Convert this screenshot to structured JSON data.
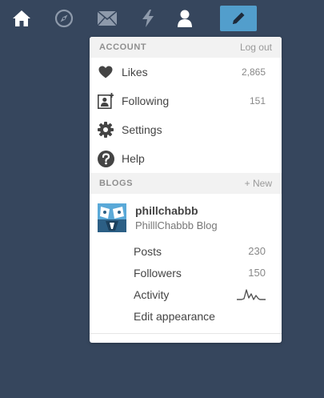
{
  "nav": {
    "icons": [
      "home-icon",
      "explore-icon",
      "mail-icon",
      "activity-icon",
      "account-icon"
    ],
    "compose_icon": "pencil-icon",
    "colors": {
      "background": "#36465d",
      "icon": "#ffffff",
      "compose_bg": "#529ecc"
    }
  },
  "account": {
    "header": "ACCOUNT",
    "logout": "Log out",
    "items": [
      {
        "icon": "heart-icon",
        "label": "Likes",
        "count": "2,865"
      },
      {
        "icon": "following-icon",
        "label": "Following",
        "count": "151"
      },
      {
        "icon": "gear-icon",
        "label": "Settings",
        "count": ""
      },
      {
        "icon": "help-icon",
        "label": "Help",
        "count": ""
      }
    ]
  },
  "blogs": {
    "header": "BLOGS",
    "new": "+ New",
    "blog": {
      "name": "phillchabbb",
      "title": "PhilllChabbb Blog",
      "items": [
        {
          "label": "Posts",
          "count": "230"
        },
        {
          "label": "Followers",
          "count": "150"
        },
        {
          "label": "Activity",
          "count": ""
        },
        {
          "label": "Edit appearance",
          "count": ""
        }
      ]
    }
  }
}
